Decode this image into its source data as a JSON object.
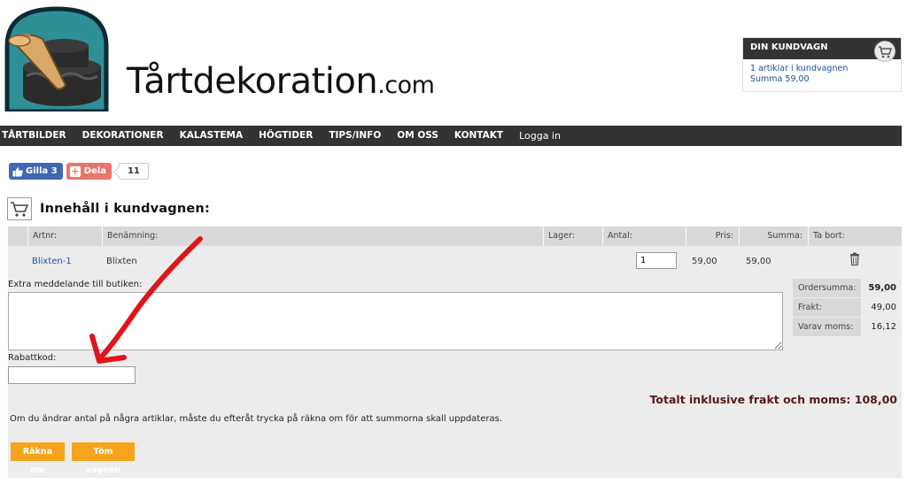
{
  "site": {
    "name": "Tårtdekoration",
    "tld": ".com"
  },
  "mini_cart": {
    "title": "DIN KUNDVAGN",
    "items_text": "1 artiklar i kundvagnen",
    "sum_text": "Summa 59,00"
  },
  "nav": {
    "items": [
      "TÅRTBILDER",
      "DEKORATIONER",
      "KALASTEMA",
      "HÖGTIDER",
      "TIPS/INFO",
      "OM OSS",
      "KONTAKT",
      "Logga in"
    ]
  },
  "social": {
    "like_label": "Gilla 3",
    "share_label": "Dela",
    "share_count": "11"
  },
  "cart": {
    "heading": "Innehåll i kundvagnen:",
    "columns": {
      "artnr": "Artnr:",
      "name": "Benämning:",
      "stock": "Lager:",
      "qty": "Antal:",
      "price": "Pris:",
      "sum": "Summa:",
      "remove": "Ta bort:"
    },
    "row": {
      "artnr": "Blixten-1",
      "name": "Blixten",
      "qty": "1",
      "price": "59,00",
      "sum": "59,00"
    },
    "extra_message_label": "Extra meddelande till butiken:",
    "discount_label": "Rabattkod:",
    "summary": [
      {
        "label": "Ordersumma:",
        "value": "59,00"
      },
      {
        "label": "Frakt:",
        "value": "49,00"
      },
      {
        "label": "Varav moms:",
        "value": "16,12"
      }
    ],
    "total_text": "Totalt inklusive frakt och moms: 108,00",
    "info_text": "Om du ändrar antal på några artiklar, måste du efteråt trycka på räkna om för att summorna skall uppdateras.",
    "recalc_button": "Räkna om",
    "empty_button": "Töm vagnen"
  },
  "colors": {
    "nav_bg": "#333333",
    "button": "#f4a51b",
    "total_text": "#5a1818",
    "link": "#1f4f99",
    "annotation_arrow": "#e0141a"
  },
  "icons": [
    "logo-cake-icon",
    "cart-icon",
    "thumbs-up-icon",
    "plus-icon",
    "trash-icon",
    "red-arrow-annotation"
  ]
}
